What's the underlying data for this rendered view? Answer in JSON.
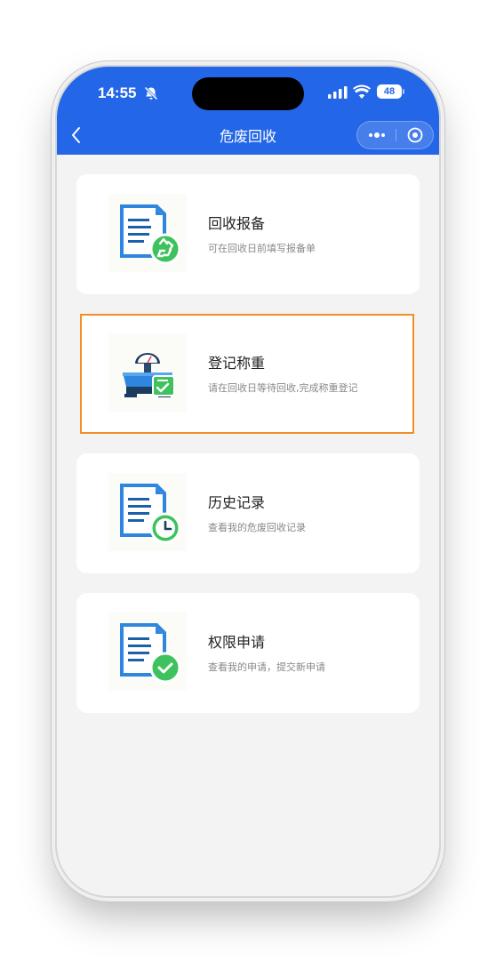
{
  "status_bar": {
    "time": "14:55",
    "battery": "48"
  },
  "nav": {
    "title": "危废回收"
  },
  "menu": [
    {
      "title": "回收报备",
      "desc": "可在回收日前填写报备单",
      "icon": "document-recycle-icon"
    },
    {
      "title": "登记称重",
      "desc": "请在回收日等待回收,完成称重登记",
      "icon": "weighing-scale-icon"
    },
    {
      "title": "历史记录",
      "desc": "查看我的危废回收记录",
      "icon": "document-clock-icon"
    },
    {
      "title": "权限申请",
      "desc": "查看我的申请，提交新申请",
      "icon": "document-check-icon"
    }
  ],
  "colors": {
    "brand": "#2366e8",
    "highlight": "#f08f26",
    "badge_green": "#3ec25d",
    "doc_blue": "#2e86de"
  }
}
